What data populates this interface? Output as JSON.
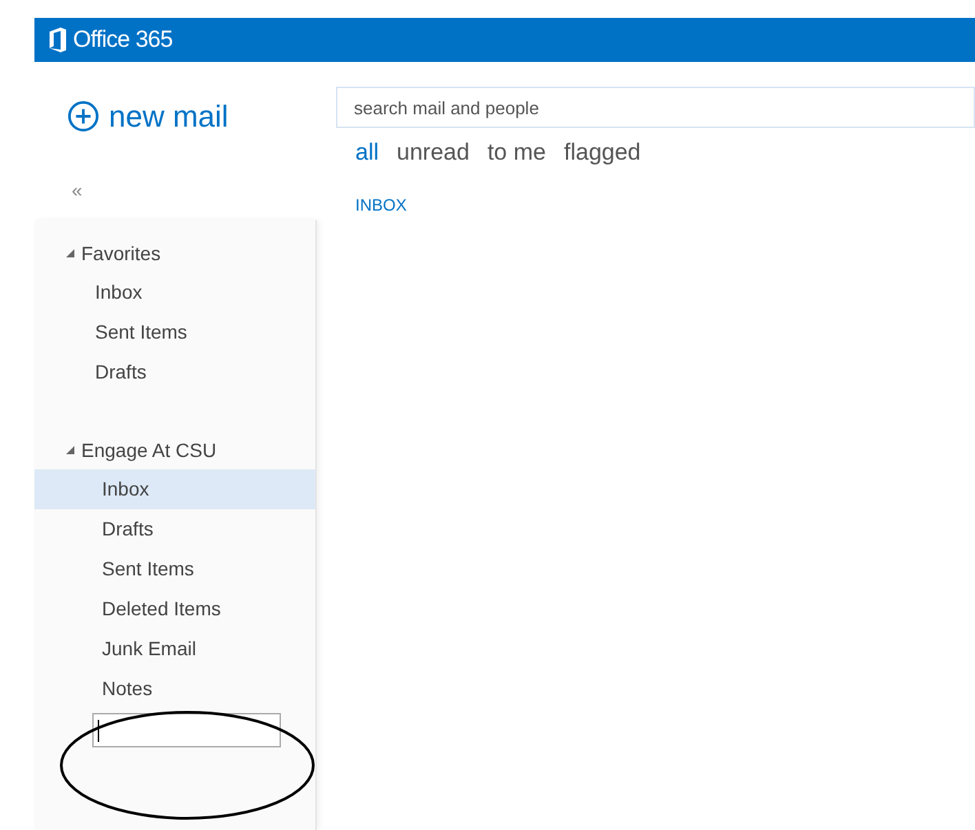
{
  "header": {
    "title": "Office 365"
  },
  "new_mail": {
    "label": "new mail"
  },
  "search": {
    "placeholder": "search mail and people"
  },
  "filters": [
    {
      "label": "all",
      "selected": true
    },
    {
      "label": "unread",
      "selected": false
    },
    {
      "label": "to me",
      "selected": false
    },
    {
      "label": "flagged",
      "selected": false
    }
  ],
  "collapse": "«",
  "folder_heading": "INBOX",
  "folder_groups": [
    {
      "name": "Favorites",
      "expanded": true,
      "children": [
        {
          "name": "Inbox",
          "selected": false
        },
        {
          "name": "Sent Items",
          "selected": false
        },
        {
          "name": "Drafts",
          "selected": false
        }
      ]
    },
    {
      "name": "Engage At CSU",
      "expanded": true,
      "children": [
        {
          "name": "Inbox",
          "selected": true
        },
        {
          "name": "Drafts",
          "selected": false
        },
        {
          "name": "Sent Items",
          "selected": false
        },
        {
          "name": "Deleted Items",
          "selected": false
        },
        {
          "name": "Junk Email",
          "selected": false
        },
        {
          "name": "Notes",
          "selected": false
        }
      ]
    }
  ],
  "new_folder_field": {
    "focused": true
  },
  "annotation": {
    "kind": "ellipse"
  }
}
